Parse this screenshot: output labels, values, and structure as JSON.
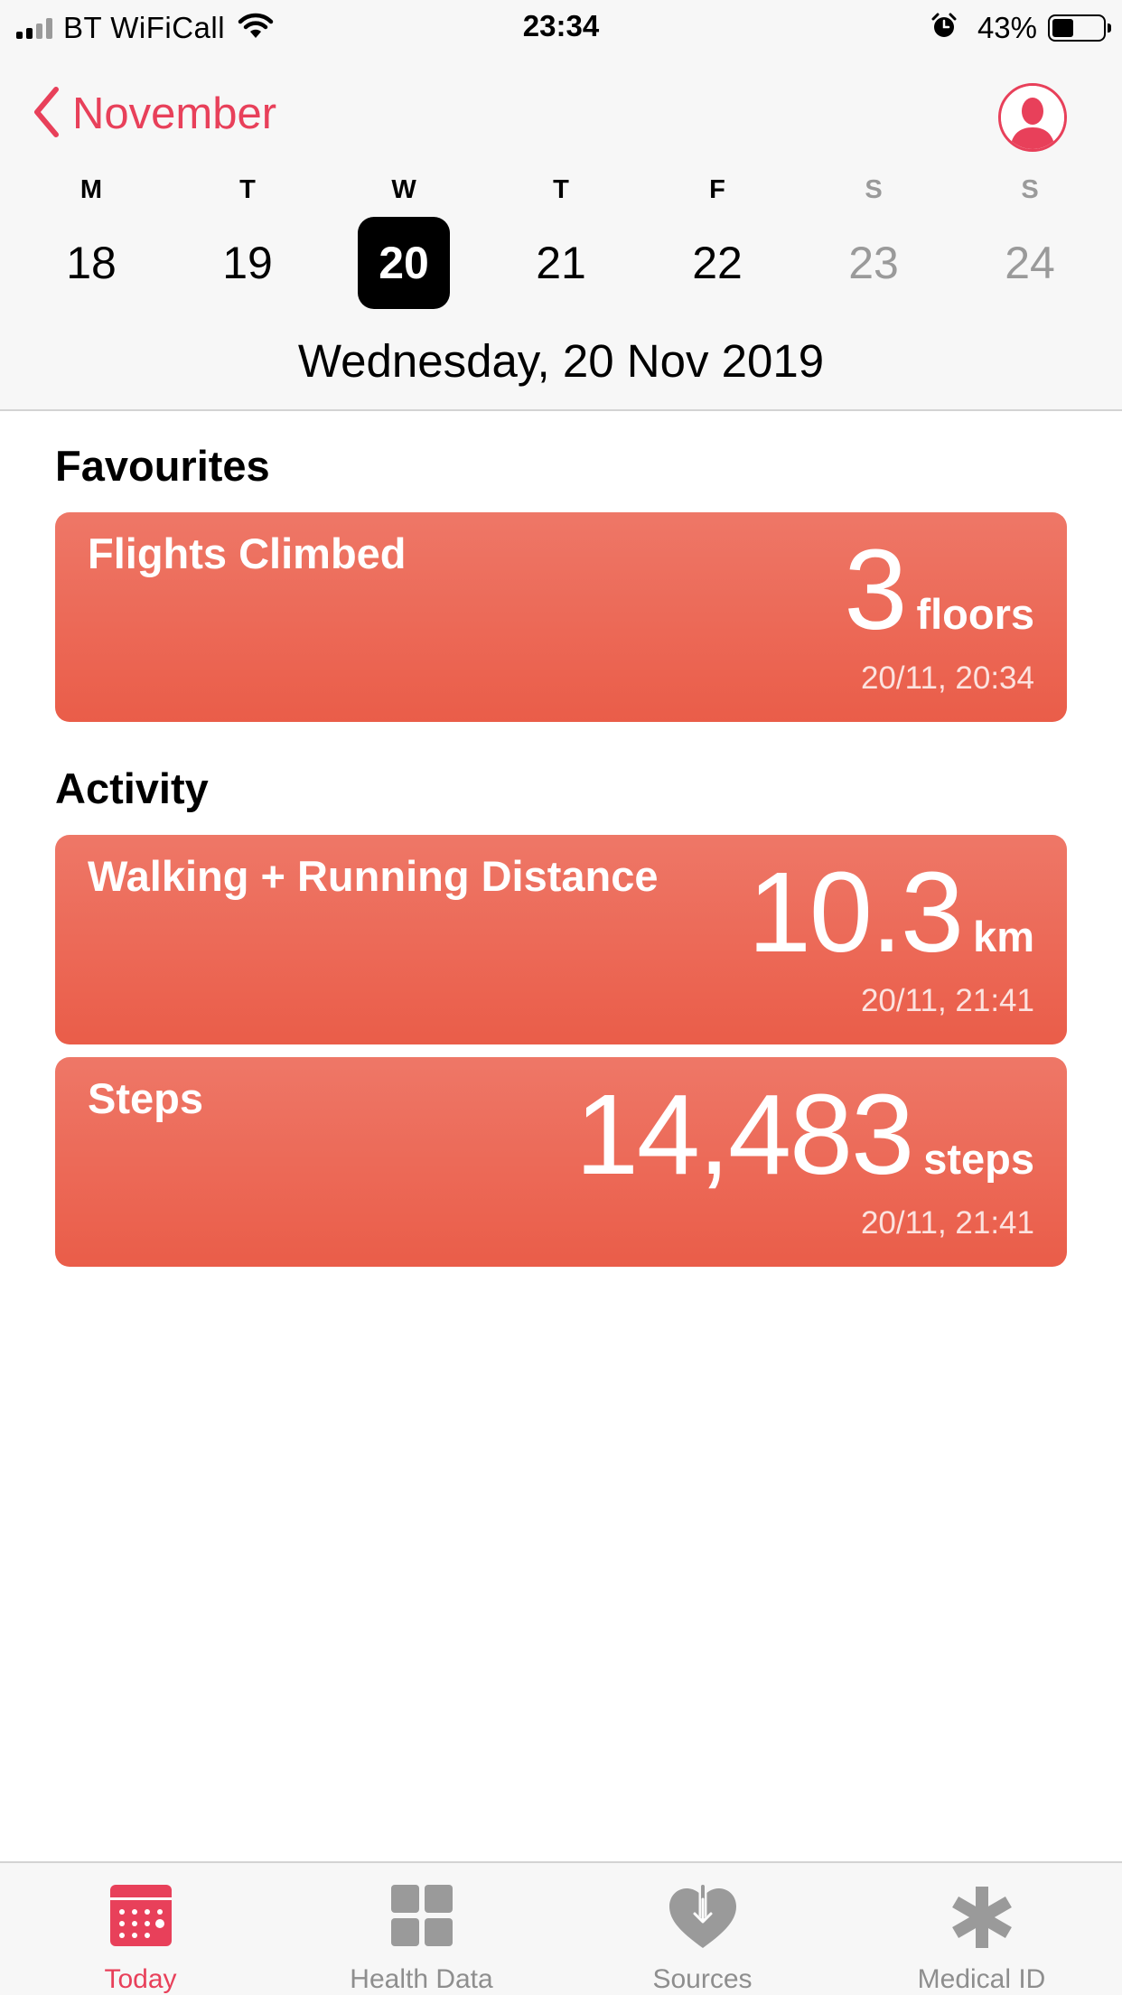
{
  "status_bar": {
    "carrier": "BT WiFiCall",
    "time": "23:34",
    "battery_percent": "43%",
    "battery_level": 0.43,
    "signal_bars": 2,
    "icons": [
      "signal-icon",
      "wifi-icon",
      "alarm-icon",
      "battery-icon"
    ]
  },
  "header": {
    "back_label": "November",
    "week_days": [
      {
        "letter": "M",
        "number": "18",
        "weekend": false,
        "selected": false
      },
      {
        "letter": "T",
        "number": "19",
        "weekend": false,
        "selected": false
      },
      {
        "letter": "W",
        "number": "20",
        "weekend": false,
        "selected": true
      },
      {
        "letter": "T",
        "number": "21",
        "weekend": false,
        "selected": false
      },
      {
        "letter": "F",
        "number": "22",
        "weekend": false,
        "selected": false
      },
      {
        "letter": "S",
        "number": "23",
        "weekend": true,
        "selected": false
      },
      {
        "letter": "S",
        "number": "24",
        "weekend": true,
        "selected": false
      }
    ],
    "full_date": "Wednesday, 20 Nov 2019"
  },
  "favourites": {
    "title": "Favourites",
    "cards": [
      {
        "title": "Flights Climbed",
        "value": "3",
        "unit": "floors",
        "time": "20/11, 20:34"
      }
    ]
  },
  "activity": {
    "title": "Activity",
    "cards": [
      {
        "title": "Walking + Running Distance",
        "value": "10.3",
        "unit": "km",
        "time": "20/11, 21:41"
      },
      {
        "title": "Steps",
        "value": "14,483",
        "unit": "steps",
        "time": "20/11, 21:41"
      }
    ]
  },
  "tab_bar": {
    "items": [
      {
        "label": "Today",
        "icon": "calendar-icon",
        "active": true
      },
      {
        "label": "Health Data",
        "icon": "grid-icon",
        "active": false
      },
      {
        "label": "Sources",
        "icon": "heart-download-icon",
        "active": false
      },
      {
        "label": "Medical ID",
        "icon": "asterisk-icon",
        "active": false
      }
    ]
  },
  "colors": {
    "accent": "#e8405a",
    "card_top": "#ee7767",
    "card_bottom": "#ea5d49",
    "inactive": "#8e8e8e",
    "weekend": "#9a9a9a"
  }
}
